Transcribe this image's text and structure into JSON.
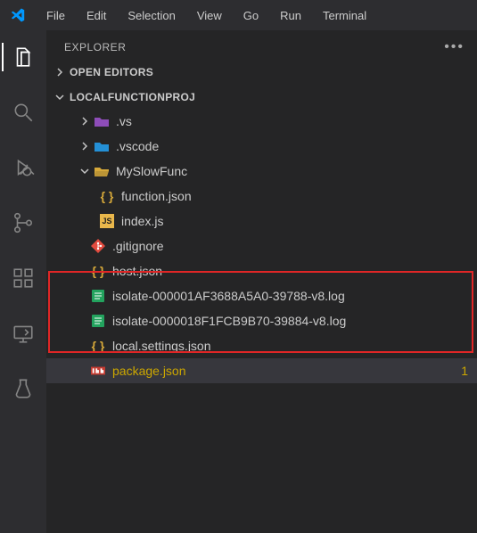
{
  "menubar": {
    "items": [
      "File",
      "Edit",
      "Selection",
      "View",
      "Go",
      "Run",
      "Terminal"
    ]
  },
  "sidebar": {
    "title": "EXPLORER",
    "sections": {
      "open_editors": "OPEN EDITORS",
      "project": "LOCALFUNCTIONPROJ"
    }
  },
  "tree": {
    "items": [
      {
        "name": ".vs",
        "kind": "folder-vs",
        "expanded": false,
        "depth": 1
      },
      {
        "name": ".vscode",
        "kind": "folder-vsc",
        "expanded": false,
        "depth": 1
      },
      {
        "name": "MySlowFunc",
        "kind": "folder-open",
        "expanded": true,
        "depth": 1
      },
      {
        "name": "function.json",
        "kind": "json",
        "depth": 2
      },
      {
        "name": "index.js",
        "kind": "js",
        "depth": 2
      },
      {
        "name": ".gitignore",
        "kind": "git",
        "depth": "1f"
      },
      {
        "name": "host.json",
        "kind": "json",
        "depth": "1f"
      },
      {
        "name": "isolate-000001AF3688A5A0-39788-v8.log",
        "kind": "log",
        "depth": "1f"
      },
      {
        "name": "isolate-0000018F1FCB9B70-39884-v8.log",
        "kind": "log",
        "depth": "1f"
      },
      {
        "name": "local.settings.json",
        "kind": "json",
        "depth": "1f"
      },
      {
        "name": "package.json",
        "kind": "json-mod",
        "depth": "1f",
        "modified": true,
        "mcount": "1",
        "selected": true
      }
    ]
  },
  "colors": {
    "folder_purple": "#8e4db9",
    "folder_blue": "#2490d6",
    "folder_yellow": "#d7a93a",
    "json": "#d7a93a",
    "js_bg": "#e9b74b",
    "js_fg": "#1e1e1e",
    "git": "#e24b3f",
    "log": "#23a35e",
    "modified": "#cca700"
  }
}
